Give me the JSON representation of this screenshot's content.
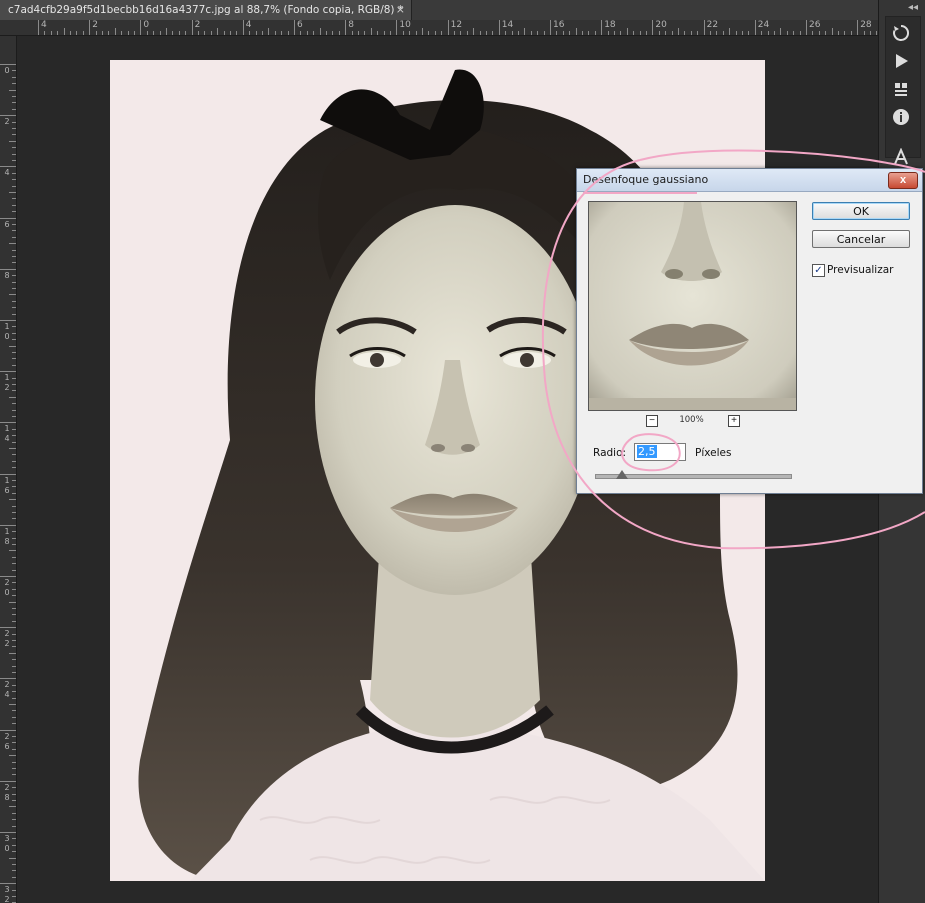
{
  "document_tab": {
    "title": "c7ad4cfb29a9f5d1becbb16d16a4377c.jpg al 88,7% (Fondo copia, RGB/8) *",
    "close_glyph": "×"
  },
  "rulers": {
    "horizontal_labels": [
      "4",
      "2",
      "0",
      "2",
      "4",
      "6",
      "8",
      "10",
      "12",
      "14",
      "16",
      "18",
      "20",
      "22",
      "24",
      "26",
      "28"
    ],
    "vertical_labels": [
      "0",
      "2",
      "4",
      "6",
      "8",
      "10",
      "12",
      "14",
      "16",
      "18",
      "20",
      "22",
      "24",
      "26",
      "28",
      "30",
      "32"
    ]
  },
  "side_panel": {
    "collapse_glyph": "◂◂",
    "icons": [
      "history-icon",
      "play-action-icon",
      "properties-icon",
      "info-icon",
      "character-icon"
    ]
  },
  "dialog": {
    "title": "Desenfoque gaussiano",
    "close_glyph": "x",
    "ok_label": "OK",
    "cancel_label": "Cancelar",
    "preview_label": "Previsualizar",
    "preview_checked": true,
    "zoom_level": "100%",
    "zoom_out_glyph": "−",
    "zoom_in_glyph": "+",
    "radius_label": "Radio:",
    "radius_value": "2,5",
    "units_label": "Píxeles"
  },
  "colors": {
    "annotation": "#f2a7c6",
    "workspace": "#282828",
    "selection": "#3399ff"
  }
}
